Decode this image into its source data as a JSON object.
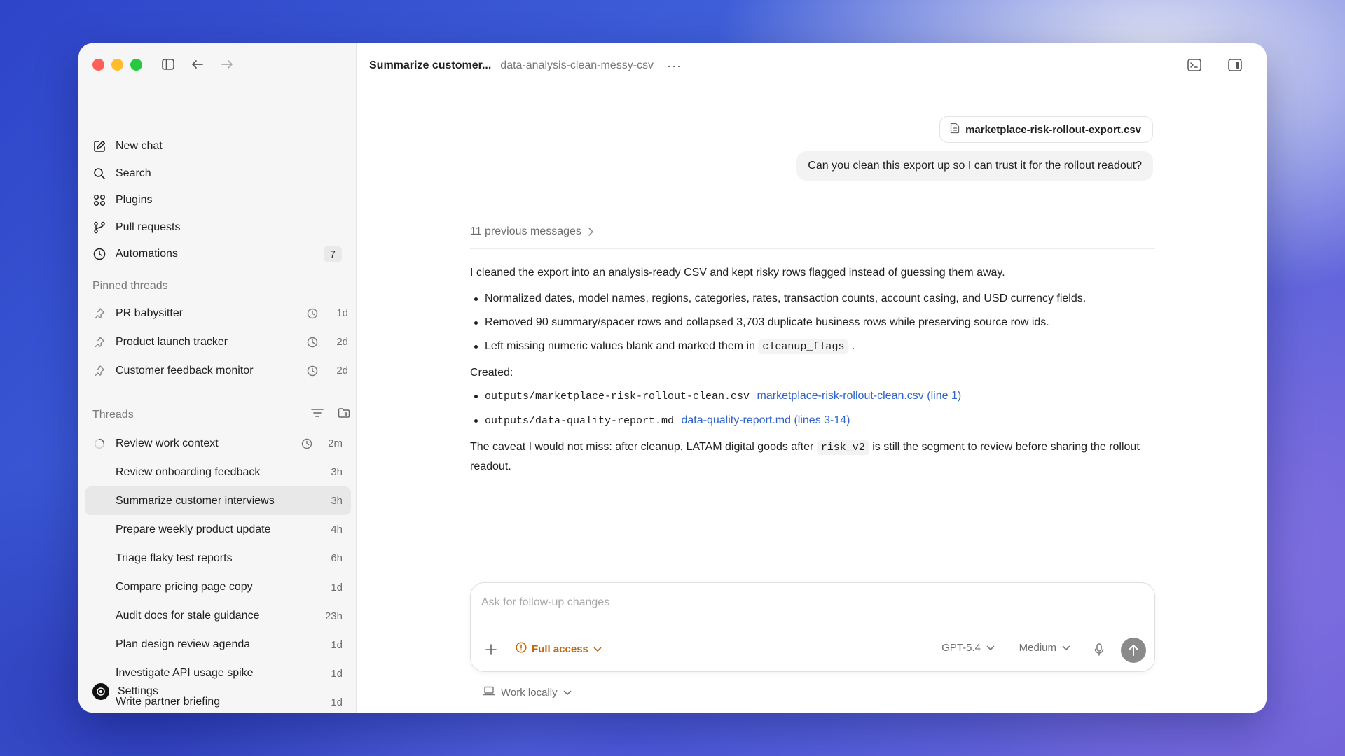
{
  "sidebar": {
    "nav": [
      {
        "label": "New chat",
        "icon": "compose-icon"
      },
      {
        "label": "Search",
        "icon": "search-icon"
      },
      {
        "label": "Plugins",
        "icon": "grid-icon"
      },
      {
        "label": "Pull requests",
        "icon": "branch-icon"
      },
      {
        "label": "Automations",
        "icon": "clock-icon",
        "badge": "7"
      }
    ],
    "pinned_label": "Pinned threads",
    "pinned": [
      {
        "label": "PR babysitter",
        "age": "1d"
      },
      {
        "label": "Product launch tracker",
        "age": "2d"
      },
      {
        "label": "Customer feedback monitor",
        "age": "2d"
      }
    ],
    "threads_label": "Threads",
    "threads": [
      {
        "label": "Review work context",
        "age": "2m",
        "running": true
      },
      {
        "label": "Review onboarding feedback",
        "age": "3h"
      },
      {
        "label": "Summarize customer interviews",
        "age": "3h",
        "selected": true
      },
      {
        "label": "Prepare weekly product update",
        "age": "4h"
      },
      {
        "label": "Triage flaky test reports",
        "age": "6h"
      },
      {
        "label": "Compare pricing page copy",
        "age": "1d"
      },
      {
        "label": "Audit docs for stale guidance",
        "age": "23h"
      },
      {
        "label": "Plan design review agenda",
        "age": "1d"
      },
      {
        "label": "Investigate API usage spike",
        "age": "1d"
      },
      {
        "label": "Write partner briefing",
        "age": "1d"
      }
    ],
    "settings_label": "Settings"
  },
  "header": {
    "title": "Summarize customer...",
    "subtitle": "data-analysis-clean-messy-csv",
    "more": "···"
  },
  "conversation": {
    "attachment": "marketplace-risk-rollout-export.csv",
    "user_message": "Can you clean this export up so I can trust it for the rollout readout?",
    "previous_messages": "11 previous messages",
    "intro": "I cleaned the export into an analysis-ready CSV and kept risky rows flagged instead of guessing them away.",
    "bullets": [
      "Normalized dates, model names, regions, categories, rates, transaction counts, account casing, and USD currency fields.",
      "Removed 90 summary/spacer rows and collapsed 3,703 duplicate business rows while preserving source row ids."
    ],
    "bullet3_pre": "Left missing numeric values blank and marked them in",
    "bullet3_code": "cleanup_flags",
    "bullet3_post": ".",
    "created_label": "Created:",
    "files": [
      {
        "path": "outputs/marketplace-risk-rollout-clean.csv",
        "link": "marketplace-risk-rollout-clean.csv (line 1)"
      },
      {
        "path": "outputs/data-quality-report.md",
        "link": "data-quality-report.md (lines 3-14)"
      }
    ],
    "caveat_pre": "The caveat I would not miss: after cleanup, LATAM digital goods after",
    "caveat_code": "risk_v2",
    "caveat_post": "is still the segment to review before sharing the rollout readout."
  },
  "composer": {
    "placeholder": "Ask for follow-up changes",
    "access_label": "Full access",
    "model_label": "GPT-5.4",
    "effort_label": "Medium",
    "work_locally": "Work locally"
  },
  "colors": {
    "accent_warning": "#c26a0a",
    "link": "#2f63c9",
    "selected_row": "#e8e8e8"
  }
}
